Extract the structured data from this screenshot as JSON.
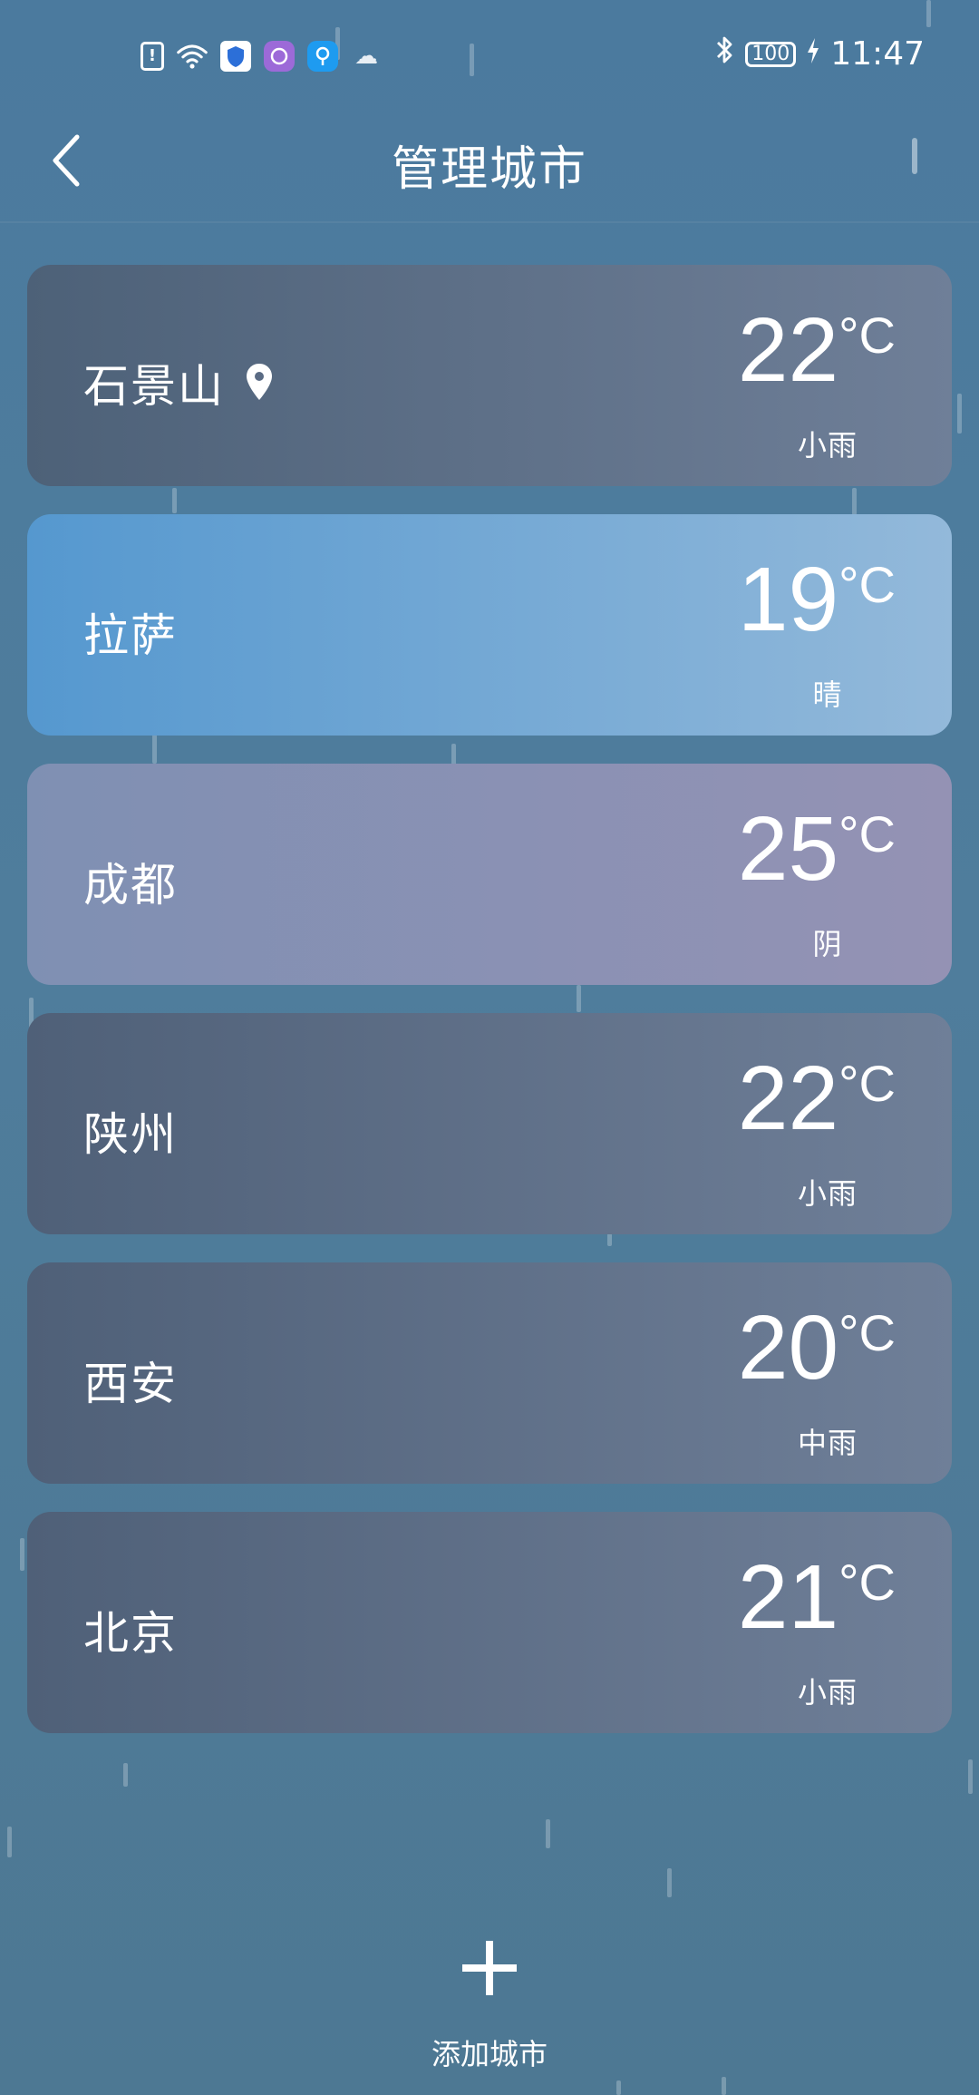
{
  "status_bar": {
    "time": "11:47",
    "battery": "100",
    "icons": [
      "sim-alert-icon",
      "wifi-icon",
      "shield-app-icon",
      "purple-app-icon",
      "blue-app-icon",
      "cloud-icon",
      "bluetooth-icon",
      "battery-icon",
      "charging-icon"
    ]
  },
  "header": {
    "title": "管理城市",
    "back_icon": "chevron-left-icon"
  },
  "cities": [
    {
      "name": "石景山",
      "temp": "22",
      "unit": "°C",
      "condition": "小雨",
      "current_location": true,
      "gradient": [
        "#4d6178",
        "#6f7f98"
      ]
    },
    {
      "name": "拉萨",
      "temp": "19",
      "unit": "°C",
      "condition": "晴",
      "current_location": false,
      "gradient": [
        "#5598cf",
        "#93b9da"
      ]
    },
    {
      "name": "成都",
      "temp": "25",
      "unit": "°C",
      "condition": "阴",
      "current_location": false,
      "gradient": [
        "#7f90b3",
        "#9492b4"
      ]
    },
    {
      "name": "陕州",
      "temp": "22",
      "unit": "°C",
      "condition": "小雨",
      "current_location": false,
      "gradient": [
        "#4f6078",
        "#6f7f98"
      ]
    },
    {
      "name": "西安",
      "temp": "20",
      "unit": "°C",
      "condition": "中雨",
      "current_location": false,
      "gradient": [
        "#4f6078",
        "#6f7f98"
      ]
    },
    {
      "name": "北京",
      "temp": "21",
      "unit": "°C",
      "condition": "小雨",
      "current_location": false,
      "gradient": [
        "#4f6078",
        "#6f7f98"
      ]
    }
  ],
  "add_city": {
    "label": "添加城市",
    "icon": "plus-icon"
  }
}
